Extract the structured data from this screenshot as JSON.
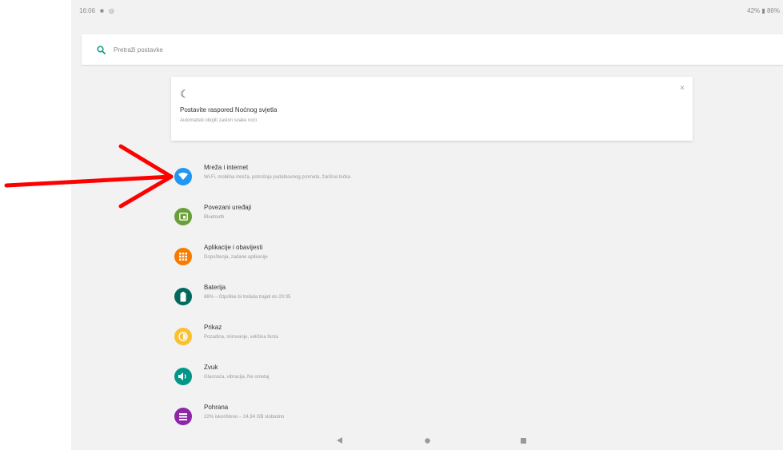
{
  "status_bar": {
    "time": "16:06",
    "right_text": "42% ▮ 86%"
  },
  "search": {
    "placeholder": "Pretraži postavke"
  },
  "suggestion": {
    "title": "Postavite raspored Noćnog svjetla",
    "subtitle": "Automatski obojiti zaslon svake noći",
    "close_label": "×"
  },
  "settings": {
    "items": [
      {
        "label": "Mreža i internet",
        "summary": "Wi-Fi, mobilna mreža, potrošnja podatkovnog prometa, žarišna točka",
        "color": "#2196F3",
        "icon": "wifi-icon"
      },
      {
        "label": "Povezani uređaji",
        "summary": "Bluetooth",
        "color": "#689F38",
        "icon": "devices-icon"
      },
      {
        "label": "Aplikacije i obavijesti",
        "summary": "Dopuštenja, zadane aplikacije",
        "color": "#F57C00",
        "icon": "apps-icon"
      },
      {
        "label": "Baterija",
        "summary": "86% – Otprilike bi trebala trajati do 20:35",
        "color": "#00695C",
        "icon": "battery-icon"
      },
      {
        "label": "Prikaz",
        "summary": "Pozadina, mirovanje, veličina fonta",
        "color": "#FBC02D",
        "icon": "brightness-icon"
      },
      {
        "label": "Zvuk",
        "summary": "Glasnoća, vibracija, Ne ometaj",
        "color": "#009688",
        "icon": "volume-icon"
      },
      {
        "label": "Pohrana",
        "summary": "22% iskorišteno – 24,94 GB slobodno",
        "color": "#8E24AA",
        "icon": "storage-icon"
      }
    ]
  },
  "annotation": {
    "arrow_color": "#ff0000"
  }
}
